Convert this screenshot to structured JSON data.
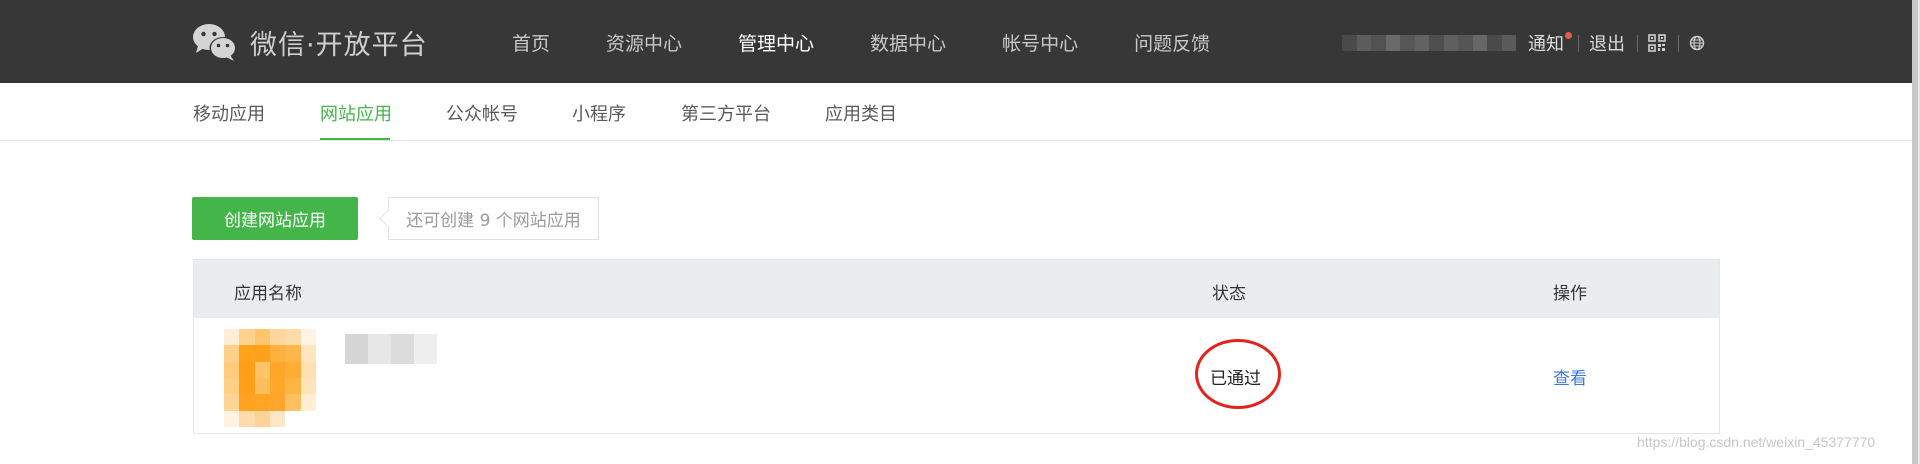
{
  "brand": {
    "title": "微信·开放平台",
    "icon": "wechat-logo-icon"
  },
  "main_nav": [
    {
      "label": "首页",
      "active": false
    },
    {
      "label": "资源中心",
      "active": false
    },
    {
      "label": "管理中心",
      "active": true
    },
    {
      "label": "数据中心",
      "active": false
    },
    {
      "label": "帐号中心",
      "active": false
    },
    {
      "label": "问题反馈",
      "active": false
    }
  ],
  "toolbar": {
    "notify_label": "通知",
    "logout_label": "退出",
    "qrcode_icon": "qrcode-icon",
    "language_icon": "globe-icon"
  },
  "sub_nav": [
    {
      "label": "移动应用",
      "active": false
    },
    {
      "label": "网站应用",
      "active": true
    },
    {
      "label": "公众帐号",
      "active": false
    },
    {
      "label": "小程序",
      "active": false
    },
    {
      "label": "第三方平台",
      "active": false
    },
    {
      "label": "应用类目",
      "active": false
    }
  ],
  "create": {
    "button_label": "创建网站应用",
    "quota_tip": "还可创建 9 个网站应用"
  },
  "table": {
    "headers": {
      "name": "应用名称",
      "status": "状态",
      "action": "操作"
    },
    "rows": [
      {
        "status": "已通过",
        "action": "查看"
      }
    ]
  },
  "watermark": "https://blog.csdn.net/weixin_45377770",
  "colors": {
    "topbar": "#373737",
    "accent_green": "#44b549",
    "link_blue": "#3d7bd8",
    "annotation_red": "#e5231d",
    "table_header": "#eaedf0"
  }
}
